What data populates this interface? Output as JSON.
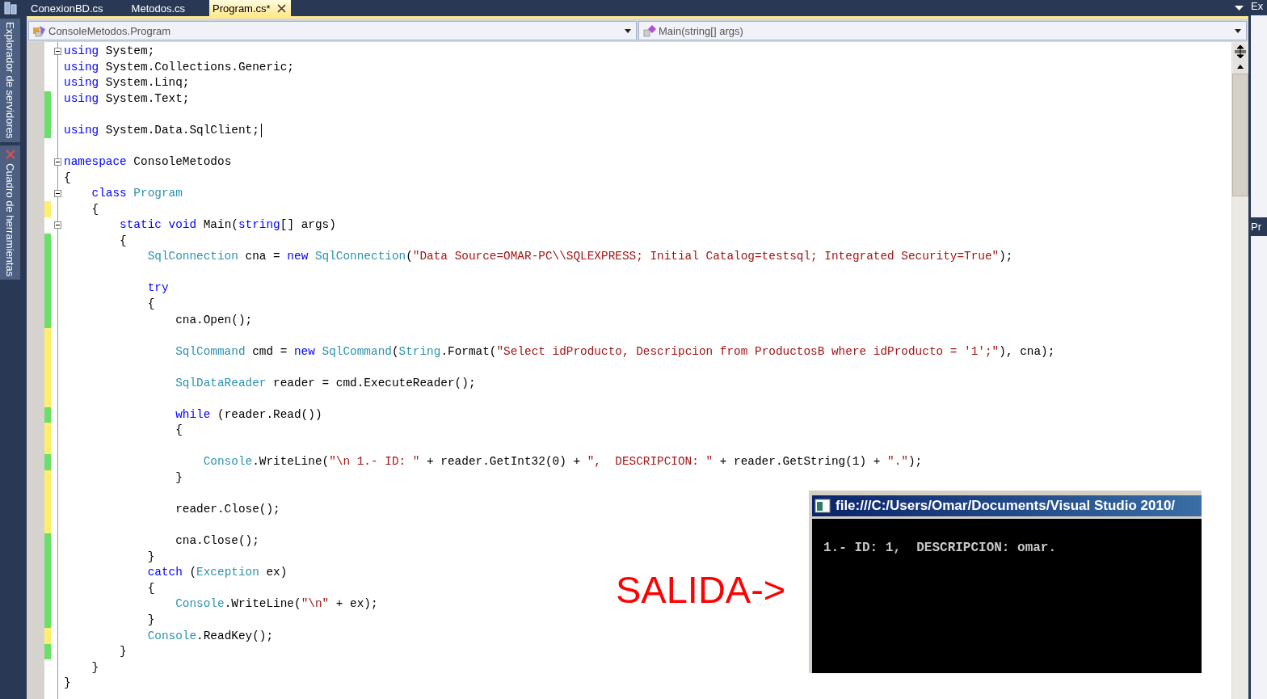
{
  "tool_windows": [
    {
      "label": "Explorador de servidores"
    },
    {
      "label": "Cuadro de herramientas"
    }
  ],
  "tabs": [
    {
      "label": "ConexionBD.cs",
      "selected": false
    },
    {
      "label": "Metodos.cs",
      "selected": false
    },
    {
      "label": "Program.cs*",
      "selected": true
    }
  ],
  "nav": {
    "type_combo": "ConsoleMetodos.Program",
    "member_combo": "Main(string[] args)"
  },
  "code_lines": [
    {
      "fold": true,
      "cursor": false,
      "changed": false,
      "tokens": [
        {
          "kind": "kw",
          "text": "using"
        },
        {
          "kind": "plain",
          "text": " System;"
        }
      ]
    },
    {
      "fold": false,
      "cursor": false,
      "changed": false,
      "tokens": [
        {
          "kind": "kw",
          "text": "using"
        },
        {
          "kind": "plain",
          "text": " System.Collections.Generic;"
        }
      ]
    },
    {
      "fold": false,
      "cursor": false,
      "changed": false,
      "tokens": [
        {
          "kind": "kw",
          "text": "using"
        },
        {
          "kind": "plain",
          "text": " System.Linq;"
        }
      ]
    },
    {
      "fold": false,
      "cursor": false,
      "changed": true,
      "saved": true,
      "tokens": [
        {
          "kind": "kw",
          "text": "using"
        },
        {
          "kind": "plain",
          "text": " System.Text;"
        }
      ]
    },
    {
      "fold": false,
      "cursor": false,
      "changed": true,
      "saved": true
    },
    {
      "fold": false,
      "cursor": true,
      "changed": true,
      "saved": true,
      "tokens": [
        {
          "kind": "kw",
          "text": "using"
        },
        {
          "kind": "plain",
          "text": " System.Data.SqlClient;"
        }
      ]
    },
    {
      "fold": false,
      "cursor": false,
      "changed": false
    },
    {
      "fold": true,
      "cursor": false,
      "changed": false,
      "tokens": [
        {
          "kind": "kw",
          "text": "namespace"
        },
        {
          "kind": "plain",
          "text": " ConsoleMetodos"
        }
      ]
    },
    {
      "fold": false,
      "cursor": false,
      "changed": false,
      "tokens": [
        {
          "kind": "plain",
          "text": "{"
        }
      ]
    },
    {
      "fold": true,
      "cursor": false,
      "changed": false,
      "tokens": [
        {
          "kind": "kw",
          "text": "    class"
        },
        {
          "kind": "type",
          "text": " Program"
        }
      ]
    },
    {
      "fold": false,
      "cursor": false,
      "changed": true,
      "saved": false,
      "tokens": [
        {
          "kind": "plain",
          "text": "    {"
        }
      ]
    },
    {
      "fold": true,
      "cursor": false,
      "changed": false,
      "tokens": [
        {
          "kind": "kw",
          "text": "        static"
        },
        {
          "kind": "kw",
          "text": " void"
        },
        {
          "kind": "plain",
          "text": " Main("
        },
        {
          "kind": "kw",
          "text": "string"
        },
        {
          "kind": "plain",
          "text": "[] args)"
        }
      ]
    },
    {
      "fold": false,
      "cursor": false,
      "changed": true,
      "saved": true,
      "tokens": [
        {
          "kind": "plain",
          "text": "        {"
        }
      ]
    },
    {
      "fold": false,
      "cursor": false,
      "changed": true,
      "saved": true,
      "tokens": [
        {
          "kind": "type",
          "text": "            SqlConnection"
        },
        {
          "kind": "plain",
          "text": " cna = "
        },
        {
          "kind": "kw",
          "text": "new"
        },
        {
          "kind": "type",
          "text": " SqlConnection"
        },
        {
          "kind": "plain",
          "text": "("
        },
        {
          "kind": "str",
          "text": "\"Data Source=OMAR-PC\\\\SQLEXPRESS; Initial Catalog=testsql; Integrated Security=True\""
        },
        {
          "kind": "plain",
          "text": ");"
        }
      ]
    },
    {
      "fold": false,
      "cursor": false,
      "changed": true,
      "saved": true
    },
    {
      "fold": false,
      "cursor": false,
      "changed": true,
      "saved": true,
      "tokens": [
        {
          "kind": "kw",
          "text": "            try"
        }
      ]
    },
    {
      "fold": false,
      "cursor": false,
      "changed": true,
      "saved": true,
      "tokens": [
        {
          "kind": "plain",
          "text": "            {"
        }
      ]
    },
    {
      "fold": false,
      "cursor": false,
      "changed": true,
      "saved": true,
      "tokens": [
        {
          "kind": "plain",
          "text": "                cna.Open();"
        }
      ]
    },
    {
      "fold": false,
      "cursor": false,
      "changed": true,
      "saved": false
    },
    {
      "fold": false,
      "cursor": false,
      "changed": true,
      "saved": false,
      "tokens": [
        {
          "kind": "type",
          "text": "                SqlCommand"
        },
        {
          "kind": "plain",
          "text": " cmd = "
        },
        {
          "kind": "kw",
          "text": "new"
        },
        {
          "kind": "type",
          "text": " SqlCommand"
        },
        {
          "kind": "plain",
          "text": "("
        },
        {
          "kind": "type",
          "text": "String"
        },
        {
          "kind": "plain",
          "text": ".Format("
        },
        {
          "kind": "str",
          "text": "\"Select idProducto, Descripcion from ProductosB where idProducto = '1';\""
        },
        {
          "kind": "plain",
          "text": "), cna);"
        }
      ]
    },
    {
      "fold": false,
      "cursor": false,
      "changed": true,
      "saved": false
    },
    {
      "fold": false,
      "cursor": false,
      "changed": true,
      "saved": false,
      "tokens": [
        {
          "kind": "type",
          "text": "                SqlDataReader"
        },
        {
          "kind": "plain",
          "text": " reader = cmd.ExecuteReader();"
        }
      ]
    },
    {
      "fold": false,
      "cursor": false,
      "changed": true,
      "saved": false
    },
    {
      "fold": false,
      "cursor": false,
      "changed": true,
      "saved": true,
      "tokens": [
        {
          "kind": "kw",
          "text": "                while"
        },
        {
          "kind": "plain",
          "text": " (reader.Read())"
        }
      ]
    },
    {
      "fold": false,
      "cursor": false,
      "changed": true,
      "saved": false,
      "tokens": [
        {
          "kind": "plain",
          "text": "                {"
        }
      ]
    },
    {
      "fold": false,
      "cursor": false,
      "changed": true,
      "saved": false
    },
    {
      "fold": false,
      "cursor": false,
      "changed": true,
      "saved": true,
      "tokens": [
        {
          "kind": "type",
          "text": "                    Console"
        },
        {
          "kind": "plain",
          "text": ".WriteLine("
        },
        {
          "kind": "str",
          "text": "\"\\n 1.- ID: \""
        },
        {
          "kind": "plain",
          "text": " + reader.GetInt32(0) + "
        },
        {
          "kind": "str",
          "text": "\",  DESCRIPCION: \""
        },
        {
          "kind": "plain",
          "text": " + reader.GetString(1) + "
        },
        {
          "kind": "str",
          "text": "\".\""
        },
        {
          "kind": "plain",
          "text": ");"
        }
      ]
    },
    {
      "fold": false,
      "cursor": false,
      "changed": true,
      "saved": false,
      "tokens": [
        {
          "kind": "plain",
          "text": "                }"
        }
      ]
    },
    {
      "fold": false,
      "cursor": false,
      "changed": true,
      "saved": false
    },
    {
      "fold": false,
      "cursor": false,
      "changed": true,
      "saved": false,
      "tokens": [
        {
          "kind": "plain",
          "text": "                reader.Close();"
        }
      ]
    },
    {
      "fold": false,
      "cursor": false,
      "changed": true,
      "saved": false
    },
    {
      "fold": false,
      "cursor": false,
      "changed": true,
      "saved": true,
      "tokens": [
        {
          "kind": "plain",
          "text": "                cna.Close();"
        }
      ]
    },
    {
      "fold": false,
      "cursor": false,
      "changed": true,
      "saved": true,
      "tokens": [
        {
          "kind": "plain",
          "text": "            }"
        }
      ]
    },
    {
      "fold": false,
      "cursor": false,
      "changed": true,
      "saved": true,
      "tokens": [
        {
          "kind": "kw",
          "text": "            catch"
        },
        {
          "kind": "plain",
          "text": " ("
        },
        {
          "kind": "type",
          "text": "Exception"
        },
        {
          "kind": "plain",
          "text": " ex)"
        }
      ]
    },
    {
      "fold": false,
      "cursor": false,
      "changed": true,
      "saved": true,
      "tokens": [
        {
          "kind": "plain",
          "text": "            {"
        }
      ]
    },
    {
      "fold": false,
      "cursor": false,
      "changed": true,
      "saved": true,
      "tokens": [
        {
          "kind": "type",
          "text": "                Console"
        },
        {
          "kind": "plain",
          "text": ".WriteLine("
        },
        {
          "kind": "str",
          "text": "\"\\n\""
        },
        {
          "kind": "plain",
          "text": " + ex);"
        }
      ]
    },
    {
      "fold": false,
      "cursor": false,
      "changed": true,
      "saved": true,
      "tokens": [
        {
          "kind": "plain",
          "text": "            }"
        }
      ]
    },
    {
      "fold": false,
      "cursor": false,
      "changed": true,
      "saved": false,
      "tokens": [
        {
          "kind": "type",
          "text": "            Console"
        },
        {
          "kind": "plain",
          "text": ".ReadKey();"
        }
      ]
    },
    {
      "fold": false,
      "cursor": false,
      "changed": true,
      "saved": true,
      "tokens": [
        {
          "kind": "plain",
          "text": "        }"
        }
      ]
    },
    {
      "fold": false,
      "cursor": false,
      "changed": false,
      "tokens": [
        {
          "kind": "plain",
          "text": "    }"
        }
      ]
    },
    {
      "fold": false,
      "cursor": false,
      "changed": false,
      "tokens": [
        {
          "kind": "plain",
          "text": "}"
        }
      ]
    }
  ],
  "right_panel": {
    "top_label": "Ex",
    "bottom_label": "Pr"
  },
  "annotation": "SALIDA->",
  "console_window": {
    "title": "file:///C:/Users/Omar/Documents/Visual Studio 2010/",
    "output": "1.- ID: 1,  DESCRIPCION: omar."
  }
}
